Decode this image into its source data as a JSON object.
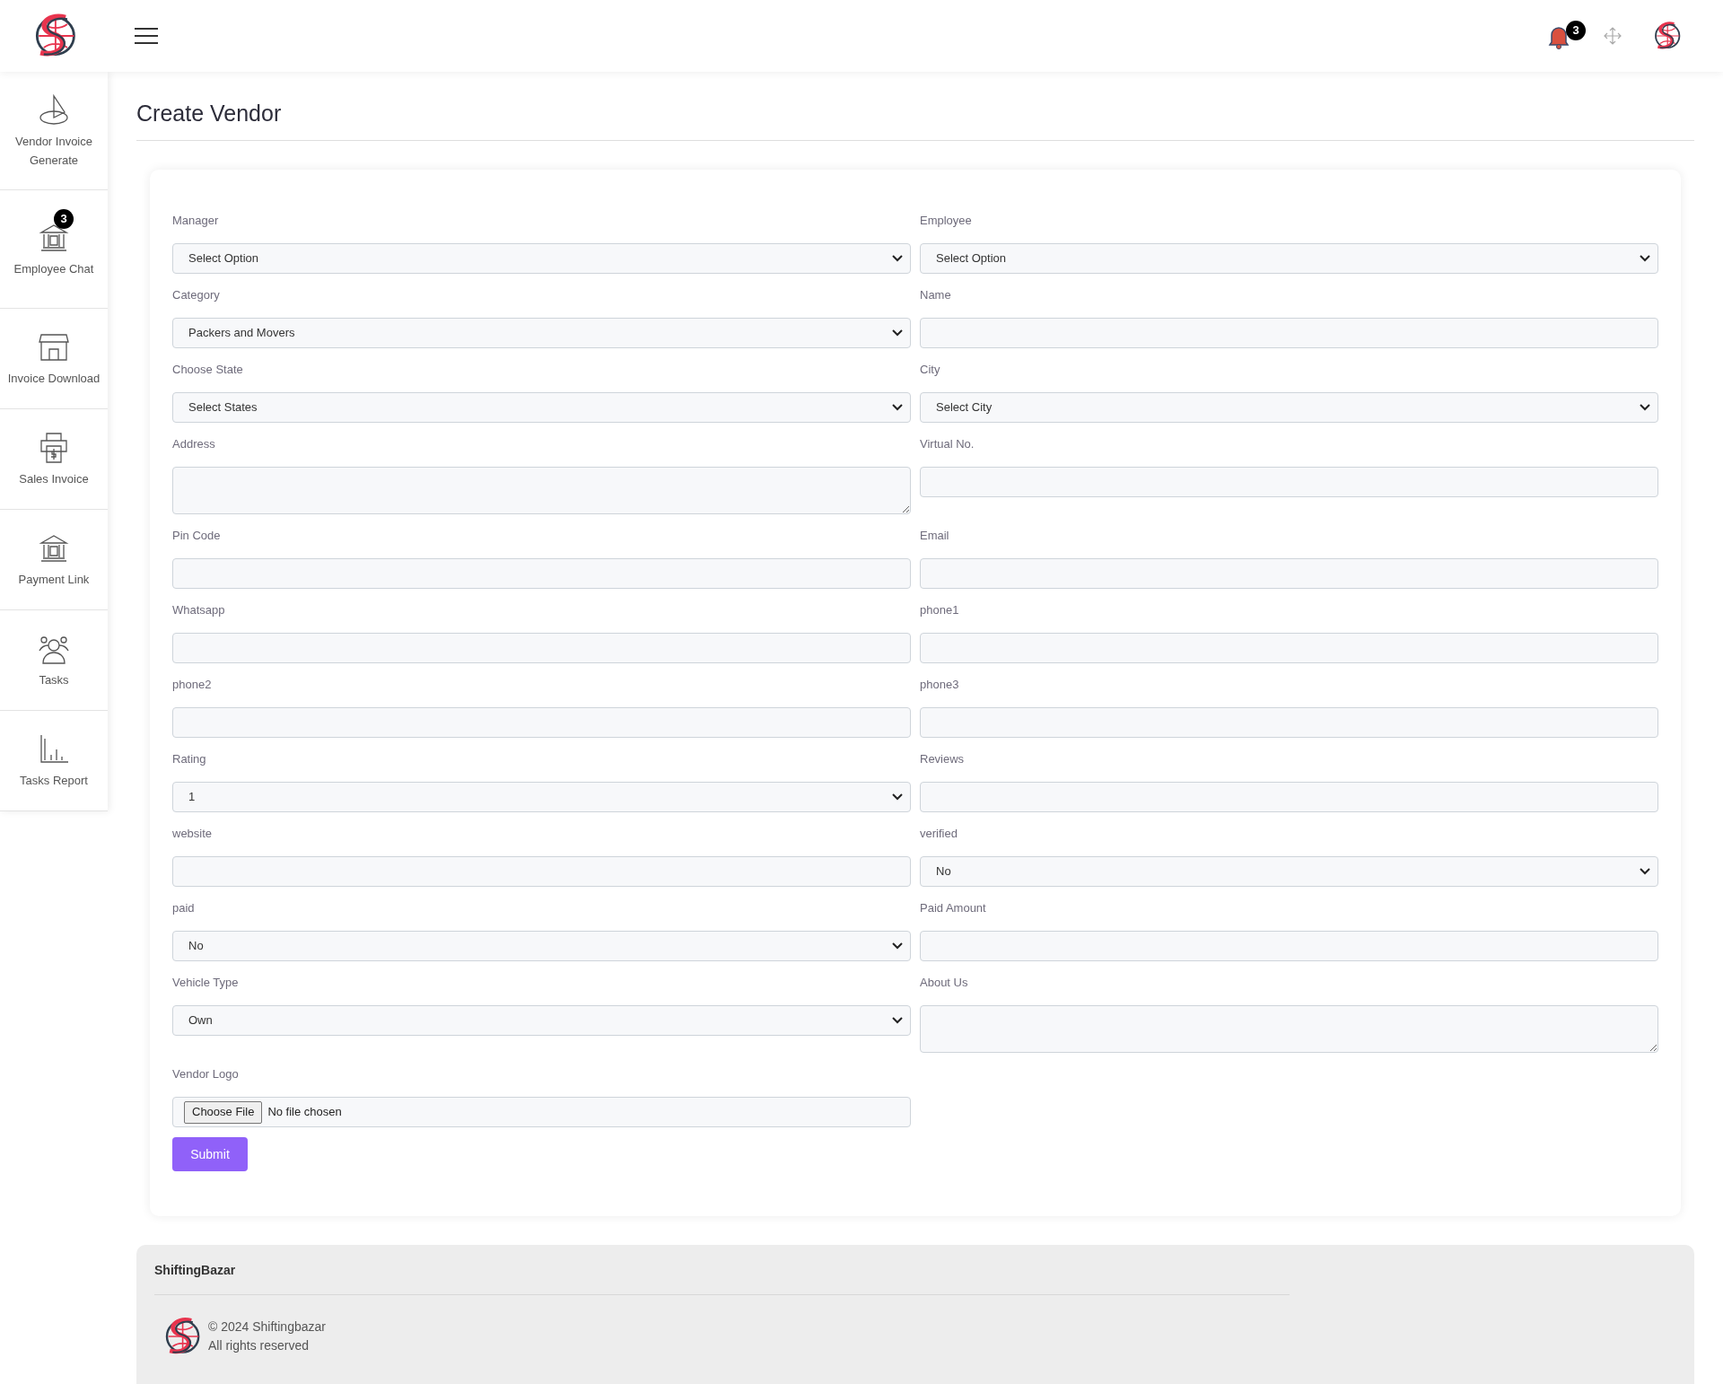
{
  "header": {
    "notification_count": "3"
  },
  "sidebar": {
    "items": [
      {
        "label": "Vendor Invoice Generate"
      },
      {
        "label": "Employee Chat",
        "badge": "3"
      },
      {
        "label": "Invoice Download"
      },
      {
        "label": "Sales Invoice"
      },
      {
        "label": "Payment Link"
      },
      {
        "label": "Tasks"
      },
      {
        "label": "Tasks Report"
      }
    ]
  },
  "page_title": "Create Vendor",
  "form": {
    "rows": [
      [
        {
          "label": "Manager",
          "kind": "select",
          "value": "Select Option"
        },
        {
          "label": "Employee",
          "kind": "select",
          "value": "Select Option"
        }
      ],
      [
        {
          "label": "Category",
          "kind": "select",
          "value": "Packers and Movers"
        },
        {
          "label": "Name",
          "kind": "input"
        }
      ],
      [
        {
          "label": "Choose State",
          "kind": "select",
          "value": "Select States"
        },
        {
          "label": "City",
          "kind": "select",
          "value": "Select City"
        }
      ],
      [
        {
          "label": "Address",
          "kind": "textarea"
        },
        {
          "label": "Virtual No.",
          "kind": "input"
        }
      ],
      [
        {
          "label": "Pin Code",
          "kind": "input"
        },
        {
          "label": "Email",
          "kind": "input"
        }
      ],
      [
        {
          "label": "Whatsapp",
          "kind": "input"
        },
        {
          "label": "phone1",
          "kind": "input"
        }
      ],
      [
        {
          "label": "phone2",
          "kind": "input"
        },
        {
          "label": "phone3",
          "kind": "input"
        }
      ],
      [
        {
          "label": "Rating",
          "kind": "select",
          "value": "1"
        },
        {
          "label": "Reviews",
          "kind": "input"
        }
      ],
      [
        {
          "label": "website",
          "kind": "input"
        },
        {
          "label": "verified",
          "kind": "select",
          "value": "No"
        }
      ],
      [
        {
          "label": "paid",
          "kind": "select",
          "value": "No"
        },
        {
          "label": "Paid Amount",
          "kind": "input"
        }
      ],
      [
        {
          "label": "Vehicle Type",
          "kind": "select",
          "value": "Own"
        },
        {
          "label": "About Us",
          "kind": "textarea"
        }
      ],
      [
        {
          "label": "Vendor Logo",
          "kind": "file",
          "button": "Choose File",
          "value": "No file chosen"
        }
      ]
    ],
    "submit": "Submit"
  },
  "footer": {
    "brand": "ShiftingBazar",
    "copyright": "© 2024 Shiftingbazar",
    "rights": "All rights reserved"
  }
}
